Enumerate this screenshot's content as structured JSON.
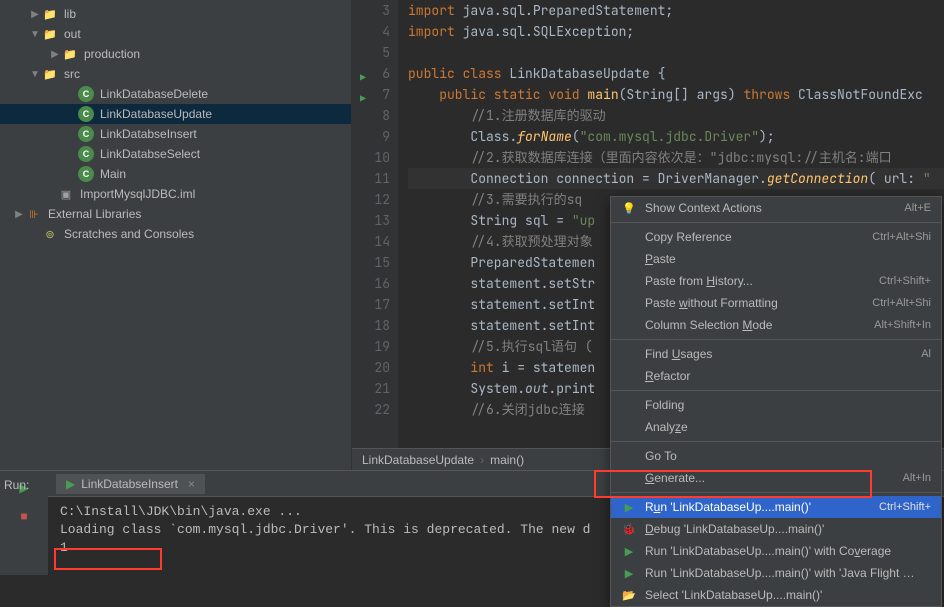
{
  "project": {
    "tree": [
      {
        "indent": 20,
        "arrow": "right",
        "icon": "folder-orange",
        "label": "lib"
      },
      {
        "indent": 20,
        "arrow": "down",
        "icon": "folder-orange",
        "label": "out"
      },
      {
        "indent": 40,
        "arrow": "right",
        "icon": "folder",
        "label": "production"
      },
      {
        "indent": 20,
        "arrow": "down",
        "icon": "folder-blue",
        "label": "src"
      },
      {
        "indent": 56,
        "arrow": "",
        "icon": "class",
        "label": "LinkDatabaseDelete"
      },
      {
        "indent": 56,
        "arrow": "",
        "icon": "class",
        "label": "LinkDatabaseUpdate",
        "selected": true
      },
      {
        "indent": 56,
        "arrow": "",
        "icon": "class",
        "label": "LinkDatabseInsert"
      },
      {
        "indent": 56,
        "arrow": "",
        "icon": "class",
        "label": "LinkDatabseSelect"
      },
      {
        "indent": 56,
        "arrow": "",
        "icon": "class",
        "label": "Main"
      },
      {
        "indent": 36,
        "arrow": "",
        "icon": "iml",
        "label": "ImportMysqlJDBC.iml"
      },
      {
        "indent": 4,
        "arrow": "right",
        "icon": "lib",
        "label": "External Libraries"
      },
      {
        "indent": 20,
        "arrow": "",
        "icon": "disk",
        "label": "Scratches and Consoles"
      }
    ]
  },
  "editor": {
    "lines": [
      {
        "num": 3,
        "html": "<span class='kw'>import</span> java.sql.PreparedStatement;"
      },
      {
        "num": 4,
        "html": "<span class='kw'>import</span> java.sql.SQLException;",
        "fold": "end"
      },
      {
        "num": 5,
        "html": ""
      },
      {
        "num": 6,
        "html": "<span class='kw'>public class</span> LinkDatabaseUpdate {",
        "run": true
      },
      {
        "num": 7,
        "html": "    <span class='kw'>public static void</span> <span class='mtd'>main</span>(String[] args) <span class='kw'>throws</span> ClassNotFoundExc",
        "run": true,
        "fold": "start"
      },
      {
        "num": 8,
        "html": "        <span class='cmt'>//1.注册数据库的驱动</span>"
      },
      {
        "num": 9,
        "html": "        Class.<span class='mtd fn'>forName</span>(<span class='str'>\"com.mysql.jdbc.Driver\"</span>);"
      },
      {
        "num": 10,
        "html": "        <span class='cmt'>//2.获取数据库连接（里面内容依次是：\"jdbc:mysql://主机名:端口</span>"
      },
      {
        "num": 11,
        "html": "        Connection <span class='type'>connection</span> = DriverManager.<span class='mtd fn'>getConnection</span>( url: <span class='str'>\"</span>",
        "hl": true
      },
      {
        "num": 12,
        "html": "        <span class='cmt'>//3.需要执行的sq</span>"
      },
      {
        "num": 13,
        "html": "        String <span class='type'>sql</span> = <span class='str'>\"up</span>"
      },
      {
        "num": 14,
        "html": "        <span class='cmt'>//4.获取预处理对象</span>"
      },
      {
        "num": 15,
        "html": "        PreparedStatemen"
      },
      {
        "num": 16,
        "html": "        statement.setStr"
      },
      {
        "num": 17,
        "html": "        statement.setInt"
      },
      {
        "num": 18,
        "html": "        statement.setInt"
      },
      {
        "num": 19,
        "html": "        <span class='cmt'>//5.执行sql语句 (</span>"
      },
      {
        "num": 20,
        "html": "        <span class='kw'>int</span> i = statemen"
      },
      {
        "num": 21,
        "html": "        System.<span class='fn'>out</span>.print"
      },
      {
        "num": 22,
        "html": "        <span class='cmt'>//6.关闭jdbc连接</span>"
      }
    ],
    "breadcrumb": [
      "LinkDatabaseUpdate",
      "main()"
    ]
  },
  "contextMenu": {
    "groups": [
      [
        {
          "icon": "bulb",
          "label": "Show Context Actions",
          "shortcut": "Alt+E"
        }
      ],
      [
        {
          "label": "Copy Reference",
          "shortcut": "Ctrl+Alt+Shi",
          "mnemonic": ""
        },
        {
          "label": "Paste",
          "mnemonic": "P",
          "shortcut": ""
        },
        {
          "label": "Paste from History...",
          "mnemonic": "H",
          "shortcut": "Ctrl+Shift+"
        },
        {
          "label": "Paste without Formatting",
          "mnemonic": "w",
          "shortcut": "Ctrl+Alt+Shi"
        },
        {
          "label": "Column Selection Mode",
          "mnemonic": "M",
          "shortcut": "Alt+Shift+In"
        }
      ],
      [
        {
          "label": "Find Usages",
          "mnemonic": "U",
          "shortcut": "Al"
        },
        {
          "label": "Refactor",
          "mnemonic": "R",
          "shortcut": ""
        }
      ],
      [
        {
          "label": "Folding",
          "shortcut": ""
        },
        {
          "label": "Analyze",
          "mnemonic": "z",
          "shortcut": ""
        }
      ],
      [
        {
          "label": "Go To",
          "shortcut": ""
        },
        {
          "label": "Generate...",
          "mnemonic": "G",
          "shortcut": "Alt+In"
        }
      ],
      [
        {
          "icon": "play",
          "label": "Run 'LinkDatabaseUp....main()'",
          "mnemonic": "u",
          "shortcut": "Ctrl+Shift+",
          "highlighted": true
        },
        {
          "icon": "bug",
          "label": "Debug 'LinkDatabaseUp....main()'",
          "mnemonic": "D",
          "shortcut": ""
        },
        {
          "icon": "play-cov",
          "label": "Run 'LinkDatabaseUp....main()' with Coverage",
          "mnemonic": "v",
          "shortcut": ""
        },
        {
          "icon": "play-jfr",
          "label": "Run 'LinkDatabaseUp....main()' with 'Java Flight Record",
          "shortcut": ""
        },
        {
          "icon": "open",
          "label": "Select 'LinkDatabaseUp....main()'",
          "shortcut": ""
        }
      ]
    ]
  },
  "run": {
    "label": "Run:",
    "tab": "LinkDatabseInsert",
    "output": [
      "C:\\Install\\JDK\\bin\\java.exe ...",
      "Loading class `com.mysql.jdbc.Driver'. This is deprecated. The new d",
      "1"
    ]
  }
}
